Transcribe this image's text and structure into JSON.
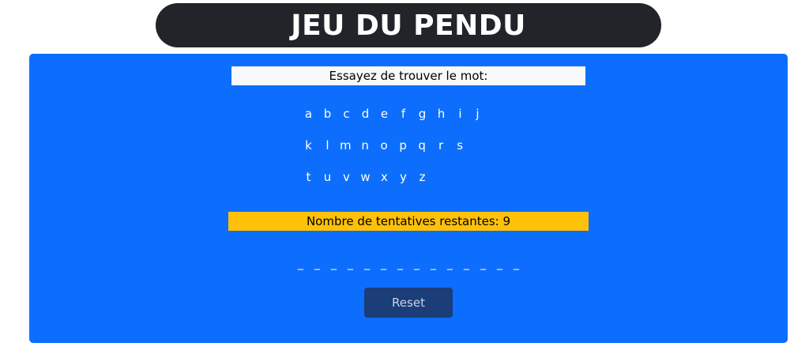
{
  "header": {
    "title": "JEU DU PENDU"
  },
  "game": {
    "prompt": "Essayez de trouver le mot:",
    "keyboard_rows": [
      [
        "a",
        "b",
        "c",
        "d",
        "e",
        "f",
        "g",
        "h",
        "i",
        "j"
      ],
      [
        "k",
        "l",
        "m",
        "n",
        "o",
        "p",
        "q",
        "r",
        "s"
      ],
      [
        "t",
        "u",
        "v",
        "w",
        "x",
        "y",
        "z"
      ]
    ],
    "attempts_label": "Nombre de tentatives restantes:",
    "attempts_remaining": "9",
    "word_slots": [
      "_",
      "_",
      "_",
      "_",
      "_",
      "_",
      "_",
      "_",
      "_",
      "_",
      "_",
      "_",
      "_",
      "_"
    ],
    "reset_label": "Reset"
  },
  "colors": {
    "panel": "#0d6efd",
    "banner": "#212529",
    "prompt_bg": "#f8f9fa",
    "attempts_bg": "#ffc107",
    "reset_bg": "#1b3d78"
  }
}
